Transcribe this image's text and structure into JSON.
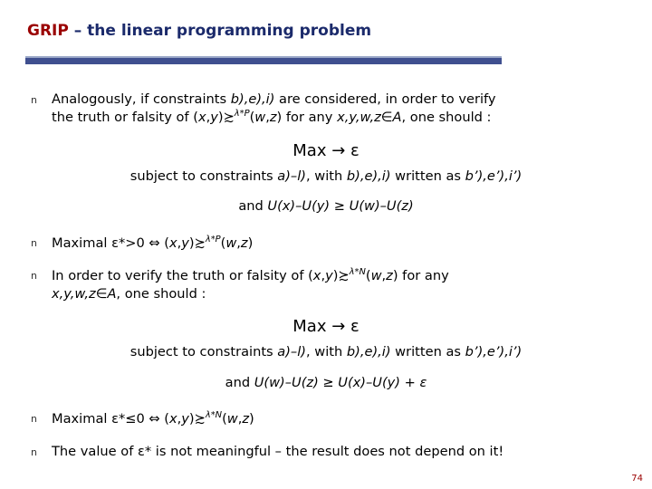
{
  "slide": {
    "title_bold": "GRIP",
    "title_rest": " – the linear programming problem",
    "page_number": "74",
    "accent_color": "#9a0000",
    "rule_color": "#3f4f8f",
    "bullet_glyph": "n"
  },
  "blocks": {
    "b1_line1_a": "Analogously, if constraints ",
    "b1_line1_b": "b),e),i)",
    "b1_line1_c": " are considered, in order to verify",
    "b1_line2_a": "the truth or falsity of (",
    "b1_line2_x": "x",
    "b1_line2_comma": ",",
    "b1_line2_y": "y",
    "b1_line2_close": ")",
    "b1_rel_sup": "λ*P",
    "b1_line2_d": "(",
    "b1_line2_w": "w",
    "b1_line2_z": "z",
    "b1_line2_e": ") for any ",
    "b1_line2_vars": "x,y,w,z",
    "b1_line2_inset": "∈",
    "b1_line2_A": "A",
    "b1_line2_f": ", one should :",
    "max_line": "Max  →  ε",
    "subject_a": "subject to constraints ",
    "subject_b": "a)–l)",
    "subject_c": ", with ",
    "subject_d": "b),e),i)",
    "subject_e": " written as ",
    "subject_f": "b’),e’),i’)",
    "and_line1_and": "and ",
    "and_line1_rest": "U(x)–U(y) ≥ U(w)–U(z)",
    "b2_a": "Maximal ε*>0 ⇔ (",
    "b2_x": "x",
    "b2_y": "y",
    "b2_sup": "λ*P",
    "b2_w": "w",
    "b2_z": "z",
    "b3_line1_a": "In order to verify the truth or falsity of (",
    "b3_sup": "λ*N",
    "b3_line1_b": ") for any",
    "b3_line2_vars": "x,y,w,z",
    "b3_line2_in": "∈",
    "b3_line2_A": "A",
    "b3_line2_b": ", one should :",
    "and_line2_and": "and ",
    "and_line2_rest": "U(w)–U(z) ≥ U(x)–U(y) + ε",
    "b4_a": "Maximal ε*≤0 ⇔ (",
    "b4_sup": "λ*N",
    "b5": "The value of ε* is not meaningful – the result does not depend on it!"
  }
}
